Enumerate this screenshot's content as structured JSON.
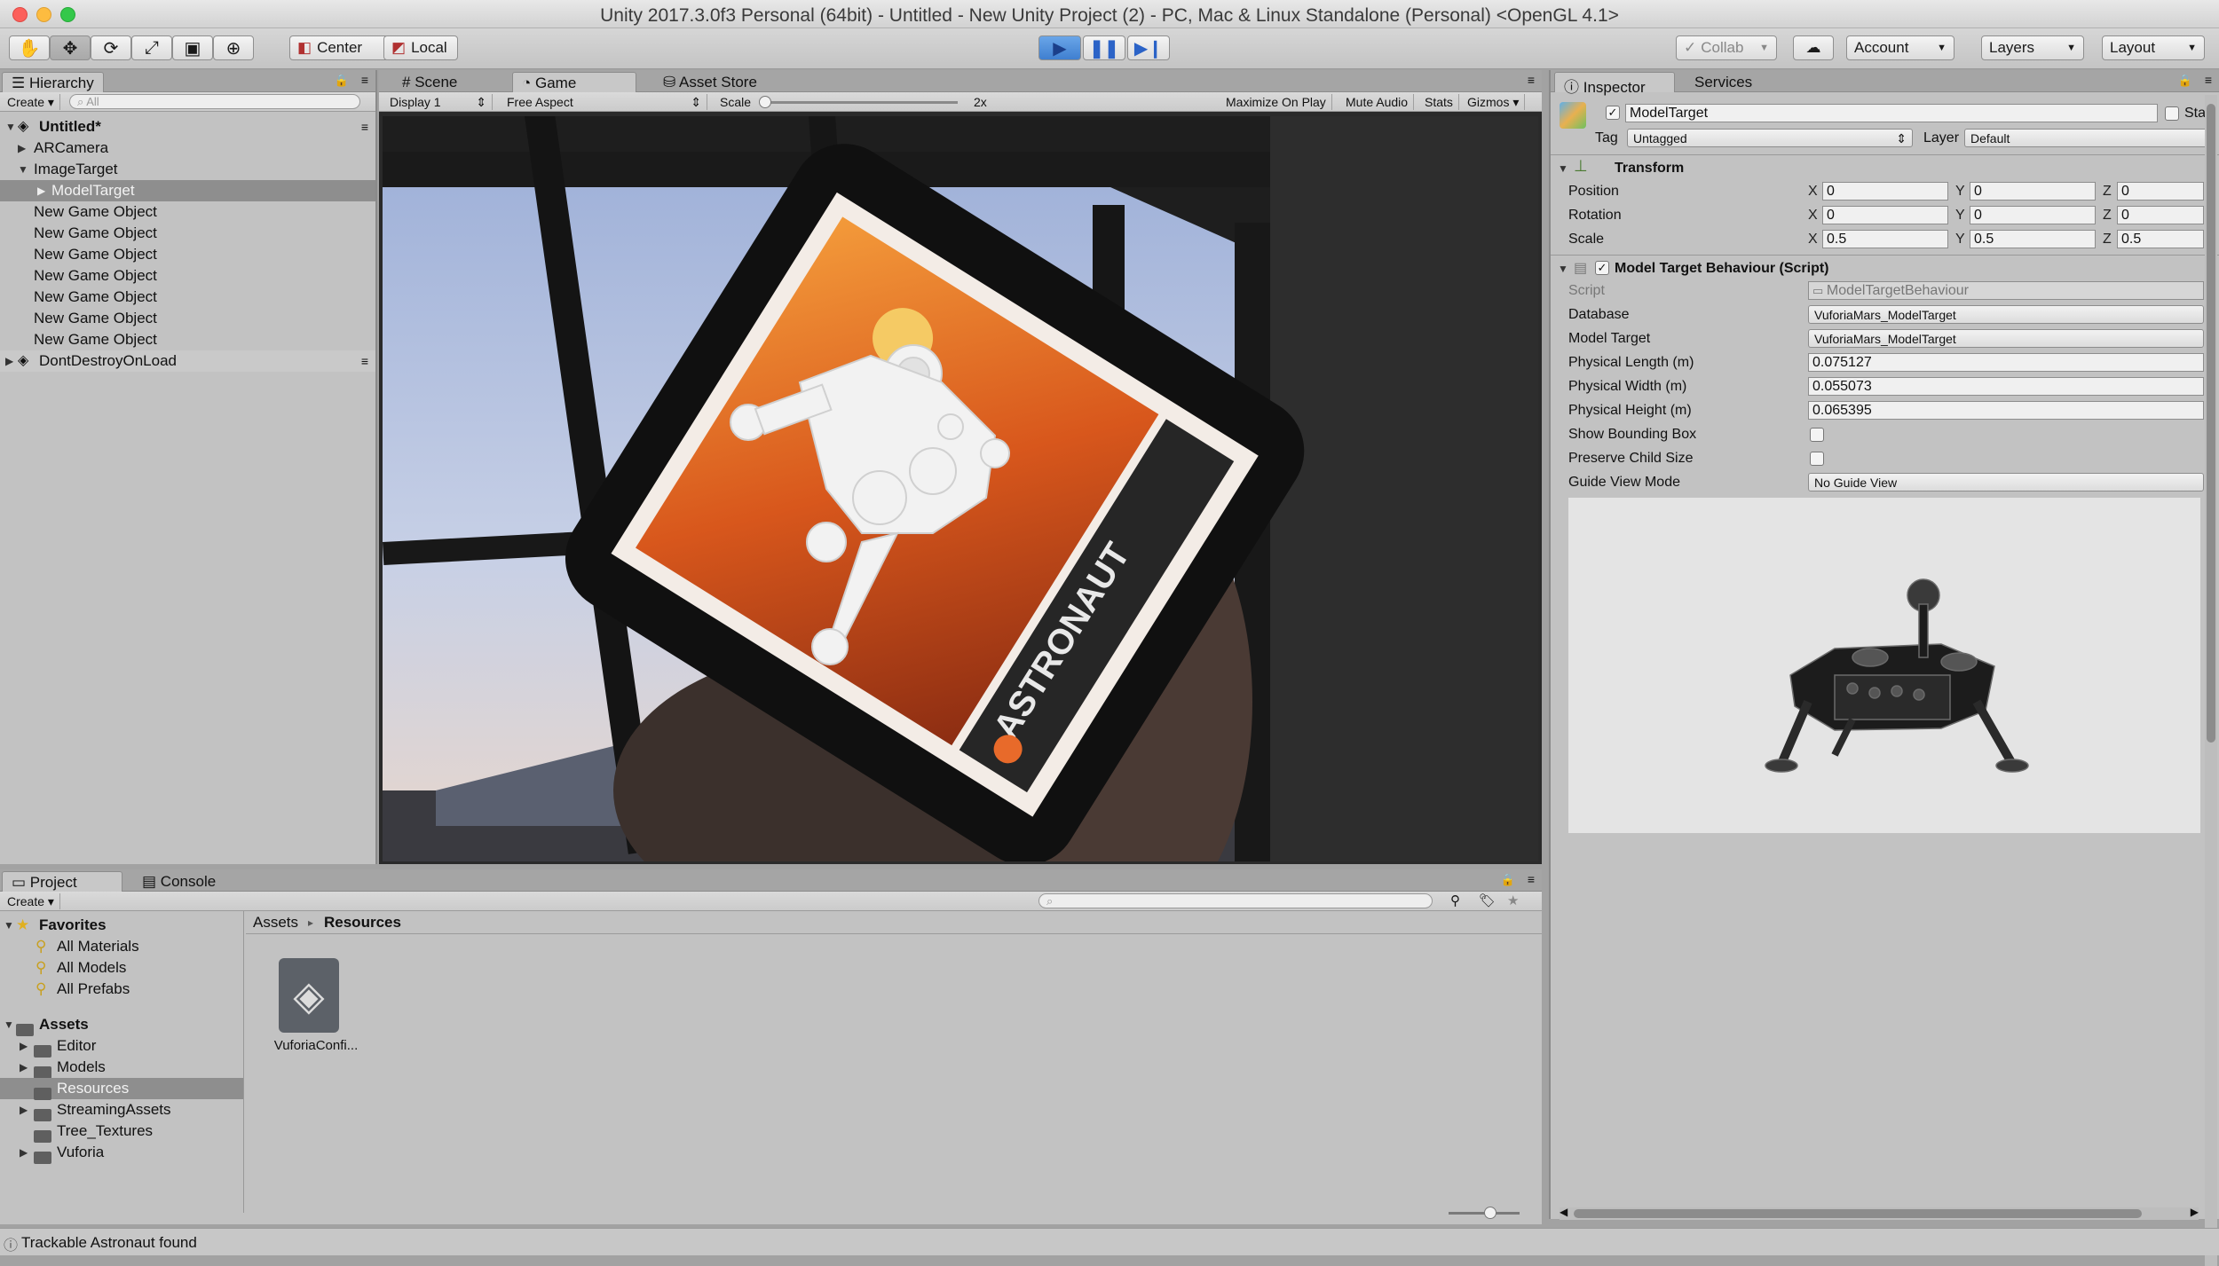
{
  "window": {
    "title": "Unity 2017.3.0f3 Personal (64bit) - Untitled - New Unity Project (2) - PC, Mac & Linux Standalone (Personal) <OpenGL 4.1>"
  },
  "toolbar": {
    "pivot_label": "Center",
    "space_label": "Local",
    "collab_label": "Collab",
    "account_label": "Account",
    "layers_label": "Layers",
    "layout_label": "Layout"
  },
  "hierarchy": {
    "tab_label": "Hierarchy",
    "create_label": "Create",
    "search_placeholder": "All",
    "scene_name": "Untitled*",
    "items": [
      "ARCamera",
      "ImageTarget",
      "ModelTarget",
      "New Game Object",
      "New Game Object",
      "New Game Object",
      "New Game Object",
      "New Game Object",
      "New Game Object",
      "New Game Object"
    ],
    "dontdestroy": "DontDestroyOnLoad"
  },
  "center": {
    "tabs": [
      "Scene",
      "Game",
      "Asset Store"
    ],
    "display": "Display 1",
    "aspect": "Free Aspect",
    "scale_label": "Scale",
    "scale_value": "2x",
    "buttons": [
      "Maximize On Play",
      "Mute Audio",
      "Stats",
      "Gizmos"
    ],
    "poster_text": "ASTRONAUT"
  },
  "inspector": {
    "tabs": [
      "Inspector",
      "Services"
    ],
    "object_name": "ModelTarget",
    "static_label": "Sta",
    "tag_label": "Tag",
    "tag_value": "Untagged",
    "layer_label": "Layer",
    "layer_value": "Default",
    "transform_title": "Transform",
    "position_label": "Position",
    "rotation_label": "Rotation",
    "scale_label": "Scale",
    "position": {
      "x": "0",
      "y": "0",
      "z": "0"
    },
    "rotation": {
      "x": "0",
      "y": "0",
      "z": "0"
    },
    "scale": {
      "x": "0.5",
      "y": "0.5",
      "z": "0.5"
    },
    "axis_labels": {
      "x": "X",
      "y": "Y",
      "z": "Z"
    },
    "component_title": "Model Target Behaviour (Script)",
    "script_label": "Script",
    "script_value": "ModelTargetBehaviour",
    "database_label": "Database",
    "database_value": "VuforiaMars_ModelTarget",
    "model_target_label": "Model Target",
    "model_target_value": "VuforiaMars_ModelTarget",
    "length_label": "Physical Length (m)",
    "length_value": "0.075127",
    "width_label": "Physical Width (m)",
    "width_value": "0.055073",
    "height_label": "Physical Height (m)",
    "height_value": "0.065395",
    "bbox_label": "Show Bounding Box",
    "preserve_label": "Preserve Child Size",
    "guide_label": "Guide View Mode",
    "guide_value": "No Guide View"
  },
  "project": {
    "tabs": [
      "Project",
      "Console"
    ],
    "create_label": "Create",
    "favorites_label": "Favorites",
    "favorites": [
      "All Materials",
      "All Models",
      "All Prefabs"
    ],
    "assets_label": "Assets",
    "folders": [
      "Editor",
      "Models",
      "Resources",
      "StreamingAssets",
      "Tree_Textures",
      "Vuforia"
    ],
    "breadcrumb_root": "Assets",
    "breadcrumb_current": "Resources",
    "asset_name": "VuforiaConfi..."
  },
  "status": {
    "message": "Trackable Astronaut found"
  }
}
